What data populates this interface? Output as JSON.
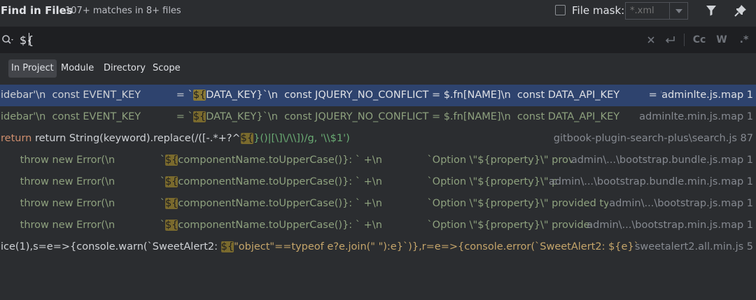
{
  "header": {
    "title": "Find in Files",
    "match_count": "107+ matches in 8+ files",
    "file_mask_label": "File mask:",
    "file_mask_placeholder": "*.xml",
    "filter_icon": "filter-icon",
    "pin_icon": "pin-icon"
  },
  "search": {
    "value": "${",
    "clear_icon": "close-icon",
    "newline_icon": "newline-icon",
    "match_case_label": "Cc",
    "words_label": "W",
    "regex_label": ".*"
  },
  "scope": {
    "tabs": [
      "In Project",
      "Module",
      "Directory",
      "Scope"
    ],
    "active": "In Project"
  },
  "results": [
    {
      "code_before": "idebar'\\n  const EVENT_KEY           = `",
      "match": "${",
      "code_after": "DATA_KEY}`\\n  const JQUERY_NO_CONFLICT = $.fn[NAME]\\n  const DATA_API_KEY         = '.data-a",
      "file": "adminlte.js.map 1",
      "selected": true
    },
    {
      "code_before": "idebar'\\n  const EVENT_KEY           = `",
      "match": "${",
      "code_after": "DATA_KEY}`\\n  const JQUERY_NO_CONFLICT = $.fn[NAME]\\n  const DATA_API_KEY         = '.da",
      "file": "adminlte.min.js.map 1",
      "selected": false
    },
    {
      "code_before": "return String(keyword).replace(/([-.*+?^",
      "match": "${",
      "code_after": "}()|[\\]\\/\\\\])/g, '\\\\$1')",
      "file": "gitbook-plugin-search-plus\\search.js 87",
      "selected": false
    },
    {
      "code_before": "      throw new Error(\\n              `",
      "match": "${",
      "code_after": "componentName.toUpperCase()}: ` +\\n              `Option \\\"${property}\\\" provided typ",
      "file": "admin\\...\\bootstrap.bundle.js.map 1",
      "selected": false
    },
    {
      "code_before": "      throw new Error(\\n              `",
      "match": "${",
      "code_after": "componentName.toUpperCase()}: ` +\\n              `Option \\\"${property}\\\" provide",
      "file": "admin\\...\\bootstrap.bundle.min.js.map 1",
      "selected": false
    },
    {
      "code_before": "      throw new Error(\\n              `",
      "match": "${",
      "code_after": "componentName.toUpperCase()}: ` +\\n              `Option \\\"${property}\\\" provided type \\\"${v",
      "file": "admin\\...\\bootstrap.js.map 1",
      "selected": false
    },
    {
      "code_before": "      throw new Error(\\n              `",
      "match": "${",
      "code_after": "componentName.toUpperCase()}: ` +\\n              `Option \\\"${property}\\\" provided type \\",
      "file": "admin\\...\\bootstrap.min.js.map 1",
      "selected": false
    },
    {
      "code_before": "ice(1),s=e=>{console.warn(`SweetAlert2: ",
      "match": "${",
      "code_after": "\"object\"==typeof e?e.join(\" \"):e}`)},r=e=>{console.error(`SweetAlert2: ${e}`)},a=[],l=(e,t)=>",
      "file": "sweetalert2.all.min.js 5",
      "selected": false
    }
  ],
  "colors": {
    "background": "#2b2d30",
    "search_background": "#1e1f22",
    "selection": "#2e436e",
    "match_highlight": "#7a6a2d"
  }
}
